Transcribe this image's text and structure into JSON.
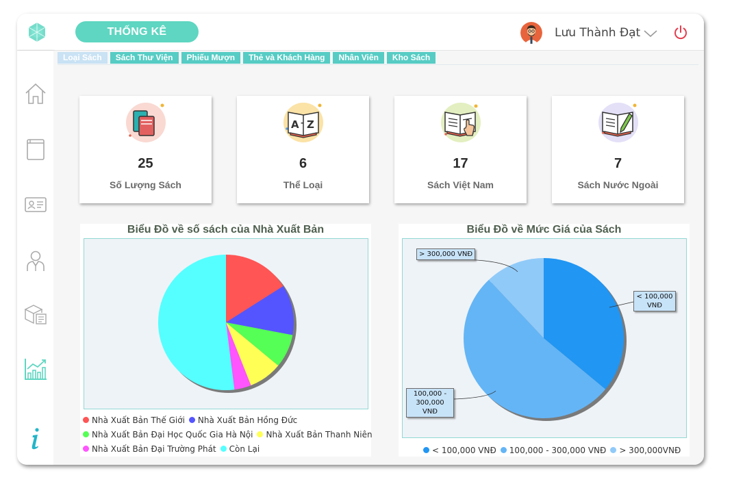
{
  "header": {
    "section_label": "THỐNG KÊ",
    "user_name": "Lưu Thành Đạt"
  },
  "tabs": [
    {
      "label": "Loại Sách",
      "active": true
    },
    {
      "label": "Sách Thư Viện",
      "active": false
    },
    {
      "label": "Phiếu Mượn",
      "active": false
    },
    {
      "label": "Thẻ và Khách Hàng",
      "active": false
    },
    {
      "label": "Nhân Viên",
      "active": false
    },
    {
      "label": "Kho Sách",
      "active": false
    }
  ],
  "sidebar": {
    "items": [
      {
        "icon": "home-icon"
      },
      {
        "icon": "book-icon"
      },
      {
        "icon": "id-card-icon"
      },
      {
        "icon": "staff-icon"
      },
      {
        "icon": "warehouse-icon"
      },
      {
        "icon": "statistics-icon",
        "active": true
      },
      {
        "icon": "info-icon"
      }
    ]
  },
  "stats": [
    {
      "value": "25",
      "label": "Số Lượng Sách",
      "icon": "books-stack-icon",
      "icon_bg": "#f9d9d2"
    },
    {
      "value": "6",
      "label": "Thể Loại",
      "icon": "az-book-icon",
      "icon_bg": "#fbe2a6"
    },
    {
      "value": "17",
      "label": "Sách Việt Nam",
      "icon": "reading-book-icon",
      "icon_bg": "#e3efc0"
    },
    {
      "value": "7",
      "label": "Sách Nước Ngoài",
      "icon": "writing-book-icon",
      "icon_bg": "#e3e0f7"
    }
  ],
  "chart_data": [
    {
      "type": "pie",
      "title": "Biểu Đồ về số sách của Nhà Xuất Bản",
      "legend_position": "bottom",
      "series": [
        {
          "name": "Nhà Xuất Bản Thế Giới",
          "value": 4,
          "color": "#ff5555"
        },
        {
          "name": "Nhà Xuất Bản Hồng Đức",
          "value": 3,
          "color": "#5555ff"
        },
        {
          "name": "Nhà Xuất Bản Đại Học Quốc Gia Hà Nội",
          "value": 2,
          "color": "#55ff55"
        },
        {
          "name": "Nhà Xuất Bản Thanh Niên",
          "value": 2,
          "color": "#ffff55"
        },
        {
          "name": "Nhà Xuất Bản Đại Trường Phát",
          "value": 1,
          "color": "#ff55ff"
        },
        {
          "name": "Còn Lại",
          "value": 13,
          "color": "#55ffff"
        }
      ]
    },
    {
      "type": "pie",
      "title": "Biểu Đồ về Mức Giá của Sách",
      "legend_position": "bottom",
      "series": [
        {
          "name": "< 100,000 VNĐ",
          "callout": "< 100,000 VNĐ",
          "value": 9,
          "color": "#2196f3"
        },
        {
          "name": "100,000 - 300,000 VNĐ",
          "callout": "100,000 - 300,000 VNĐ",
          "value": 13,
          "color": "#64b5f6"
        },
        {
          "name": "> 300,000VNĐ",
          "callout": "> 300,000 VNĐ",
          "value": 3,
          "color": "#90caf9"
        }
      ]
    }
  ]
}
